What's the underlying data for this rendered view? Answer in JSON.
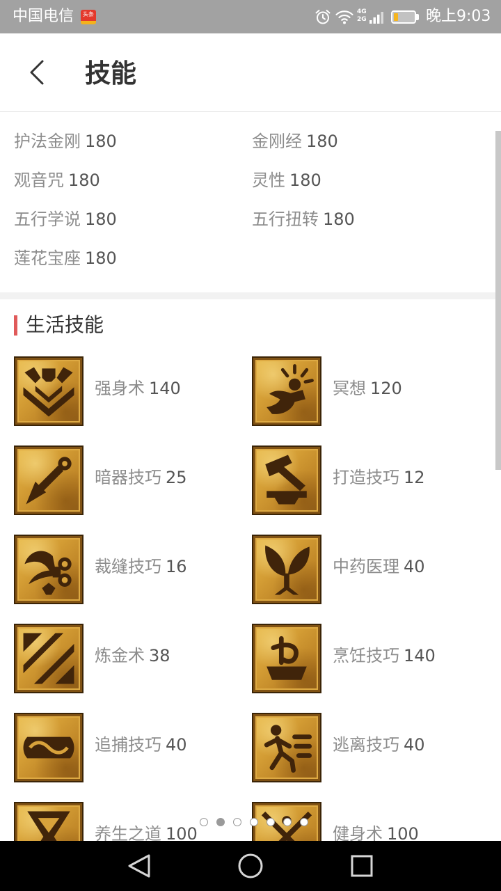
{
  "status_bar": {
    "carrier": "中国电信",
    "badge_text": "头条",
    "network_top": "4G",
    "network_bottom": "2G",
    "battery_level": 22,
    "time": "晚上9:03",
    "icons": [
      "alarm-icon",
      "wifi-icon",
      "signal-icon",
      "battery-icon"
    ]
  },
  "header": {
    "title": "技能",
    "back_icon": "chevron-left-icon"
  },
  "skills": [
    {
      "name": "护法金刚",
      "level": 180
    },
    {
      "name": "金刚经",
      "level": 180
    },
    {
      "name": "观音咒",
      "level": 180
    },
    {
      "name": "灵性",
      "level": 180
    },
    {
      "name": "五行学说",
      "level": 180
    },
    {
      "name": "五行扭转",
      "level": 180
    },
    {
      "name": "莲花宝座",
      "level": 180
    }
  ],
  "life_skills": {
    "title": "生活技能",
    "accent_color": "#e05a5a",
    "items": [
      {
        "name": "强身术",
        "level": 140,
        "icon": "strength-icon"
      },
      {
        "name": "冥想",
        "level": 120,
        "icon": "meditation-icon"
      },
      {
        "name": "暗器技巧",
        "level": 25,
        "icon": "dart-icon"
      },
      {
        "name": "打造技巧",
        "level": 12,
        "icon": "hammer-anvil-icon"
      },
      {
        "name": "裁缝技巧",
        "level": 16,
        "icon": "scissors-icon"
      },
      {
        "name": "中药医理",
        "level": 40,
        "icon": "herb-icon"
      },
      {
        "name": "炼金术",
        "level": 38,
        "icon": "alchemy-icon"
      },
      {
        "name": "烹饪技巧",
        "level": 140,
        "icon": "cooking-pot-icon"
      },
      {
        "name": "追捕技巧",
        "level": 40,
        "icon": "rope-icon"
      },
      {
        "name": "逃离技巧",
        "level": 40,
        "icon": "running-man-icon"
      },
      {
        "name": "养生之道",
        "level": 100,
        "icon": "vessel-icon"
      },
      {
        "name": "健身术",
        "level": 100,
        "icon": "fitness-icon"
      }
    ]
  },
  "pager": {
    "page_count": 7,
    "current_page": 2
  },
  "nav_bar": {
    "icons": [
      "nav-back-icon",
      "nav-home-icon",
      "nav-recents-icon"
    ]
  }
}
